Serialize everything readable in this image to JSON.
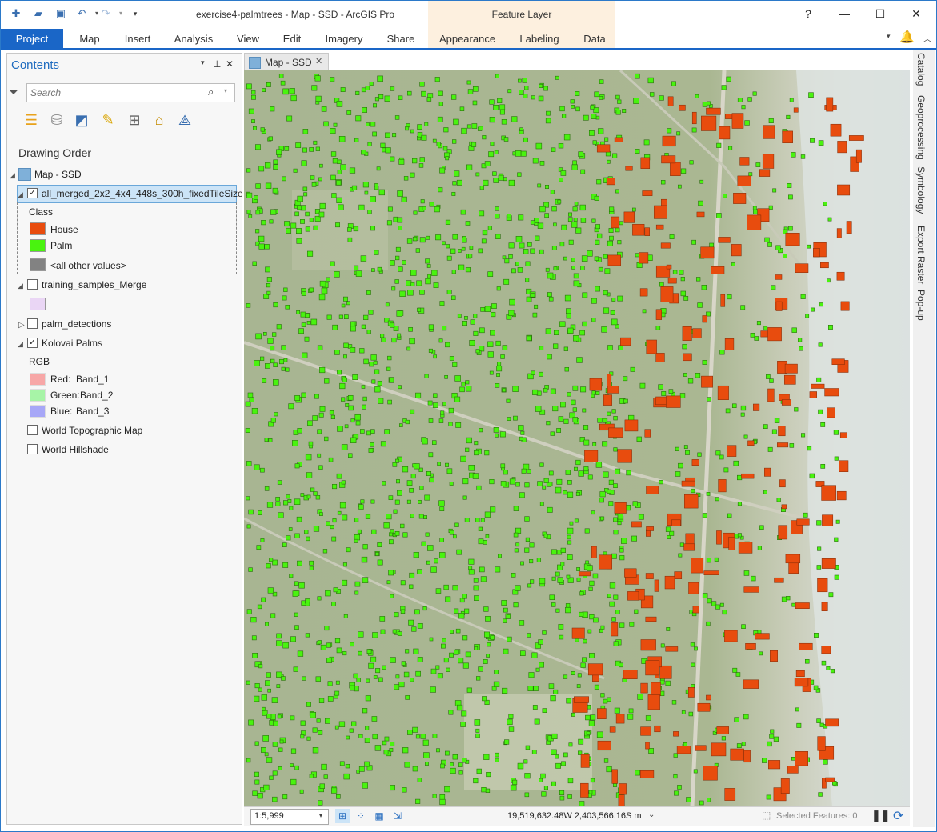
{
  "window": {
    "title": "exercise4-palmtrees - Map - SSD - ArcGIS Pro",
    "contextual_group": "Feature Layer",
    "help": "?",
    "minimize": "—",
    "maximize": "☐",
    "close": "✕"
  },
  "ribbon": {
    "tabs": [
      "Project",
      "Map",
      "Insert",
      "Analysis",
      "View",
      "Edit",
      "Imagery",
      "Share",
      "Appearance",
      "Labeling",
      "Data"
    ]
  },
  "contents": {
    "title": "Contents",
    "search_placeholder": "Search",
    "section": "Drawing Order",
    "map_name": "Map - SSD",
    "layers": {
      "merged": {
        "name": "all_merged_2x2_4x4_448s_300h_fixedTileSize",
        "checked": true,
        "field": "Class",
        "classes": [
          {
            "label": "House",
            "color": "#e84c0e"
          },
          {
            "label": "Palm",
            "color": "#49f30f"
          },
          {
            "label": "<all other values>",
            "color": "#828282"
          }
        ]
      },
      "training": {
        "name": "training_samples_Merge",
        "checked": false,
        "color": "#ead6f5"
      },
      "palm_detections": {
        "name": "palm_detections",
        "checked": false
      },
      "kolovai": {
        "name": "Kolovai Palms",
        "checked": true,
        "mode": "RGB",
        "bands": [
          {
            "label": "Red:",
            "band": "Band_1",
            "color": "#f7a7a7"
          },
          {
            "label": "Green:",
            "band": "Band_2",
            "color": "#a7f4a7"
          },
          {
            "label": "Blue:",
            "band": "Band_3",
            "color": "#a7a7f7"
          }
        ]
      },
      "topo": {
        "name": "World Topographic Map",
        "checked": false
      },
      "hillshade": {
        "name": "World Hillshade",
        "checked": false
      }
    }
  },
  "map_view": {
    "tab_label": "Map - SSD",
    "imagery_color": "#a8b592",
    "palm_color": "#49f30f",
    "house_color": "#e84c0e"
  },
  "status_bar": {
    "scale": "1:5,999",
    "coordinates": "19,519,632.48W 2,403,566.16S m",
    "selected": "Selected Features: 0"
  },
  "dock_tabs": [
    "Catalog",
    "Geoprocessing",
    "Symbology",
    "Export Raster",
    "Pop-up"
  ]
}
